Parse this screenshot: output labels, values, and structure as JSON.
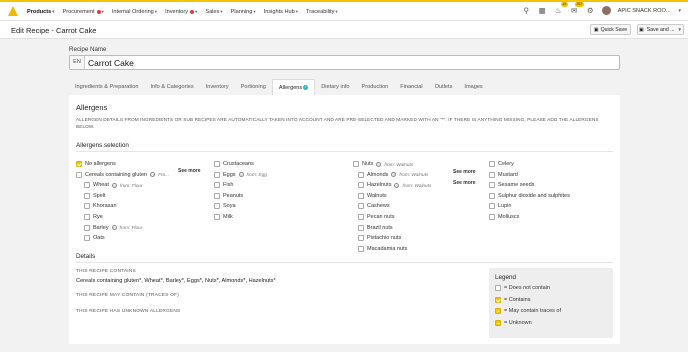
{
  "nav": {
    "items": [
      {
        "label": "Products",
        "active": true,
        "dot": false
      },
      {
        "label": "Procurement",
        "active": false,
        "dot": true
      },
      {
        "label": "Internal Ordering",
        "active": false,
        "dot": false
      },
      {
        "label": "Inventory",
        "active": false,
        "dot": true
      },
      {
        "label": "Sales",
        "active": false,
        "dot": false
      },
      {
        "label": "Planning",
        "active": false,
        "dot": false
      },
      {
        "label": "Insights Hub",
        "active": false,
        "dot": false
      },
      {
        "label": "Traceability",
        "active": false,
        "dot": false
      }
    ],
    "badge1": "14",
    "badge2": "197",
    "user": "APIC SNACK ROO...",
    "icons": [
      "search-icon",
      "store-icon",
      "bell-icon",
      "inbox-icon",
      "settings-icon"
    ]
  },
  "header": {
    "title": "Edit Recipe - Carrot Cake",
    "quick_save": "Quick Save",
    "save_and": "Save and ..."
  },
  "recipe": {
    "name_label": "Recipe Name",
    "lang": "EN",
    "name": "Carrot Cake"
  },
  "tabs": [
    {
      "label": "Ingredients & Preparation",
      "active": false
    },
    {
      "label": "Info & Categories",
      "active": false
    },
    {
      "label": "Inventory",
      "active": false
    },
    {
      "label": "Portioning",
      "active": false
    },
    {
      "label": "Allergens",
      "active": true
    },
    {
      "label": "Dietary info",
      "active": false
    },
    {
      "label": "Production",
      "active": false
    },
    {
      "label": "Financial",
      "active": false
    },
    {
      "label": "Outlets",
      "active": false
    },
    {
      "label": "Images",
      "active": false
    }
  ],
  "allergens": {
    "title": "Allergens",
    "info": "ALLERGEN DETAILS FROM INGREDIENTS OR SUB RECIPES ARE AUTOMATICALLY TAKEN INTO ACCOUNT AND ARE PRE-SELECTED AND MARKED WITH AN \"*\". IF THERE IS ANYTHING MISSING, PLEASE ADD THE ALLERGENS BELOW.",
    "selection_title": "Allergens selection",
    "see_more": "See more",
    "col1": [
      {
        "label": "No allergens",
        "state": "checked",
        "indent": false
      },
      {
        "label": "Cereals containing gluten",
        "state": "empty",
        "indent": false,
        "from": "Fro..."
      },
      {
        "label": "Wheat",
        "state": "empty",
        "indent": true,
        "from": "from: Flour"
      },
      {
        "label": "Spelt",
        "state": "empty",
        "indent": true
      },
      {
        "label": "Khorasan",
        "state": "empty",
        "indent": true
      },
      {
        "label": "Rye",
        "state": "empty",
        "indent": true
      },
      {
        "label": "Barley",
        "state": "empty",
        "indent": true,
        "from": "from: Flour"
      },
      {
        "label": "Oats",
        "state": "empty",
        "indent": true
      }
    ],
    "col2": [
      {
        "label": "Crustaceans",
        "state": "empty"
      },
      {
        "label": "Eggs",
        "state": "empty",
        "from": "from: Egg"
      },
      {
        "label": "Fish",
        "state": "empty"
      },
      {
        "label": "Peanuts",
        "state": "empty"
      },
      {
        "label": "Soya",
        "state": "empty"
      },
      {
        "label": "Milk",
        "state": "empty"
      }
    ],
    "col3": [
      {
        "label": "Nuts",
        "state": "empty",
        "indent": false,
        "from": "from: Walnuts"
      },
      {
        "label": "Almonds",
        "state": "empty",
        "indent": true,
        "from": "from: Walnuts"
      },
      {
        "label": "Hazelnuts",
        "state": "empty",
        "indent": true,
        "from": "from: Walnuts"
      },
      {
        "label": "Walnuts",
        "state": "empty",
        "indent": true
      },
      {
        "label": "Cashews",
        "state": "empty",
        "indent": true
      },
      {
        "label": "Pecan nuts",
        "state": "empty",
        "indent": true
      },
      {
        "label": "Brazil nuts",
        "state": "empty",
        "indent": true
      },
      {
        "label": "Pistachio nuts",
        "state": "empty",
        "indent": true
      },
      {
        "label": "Macadamia nuts",
        "state": "empty",
        "indent": true
      }
    ],
    "col4": [
      {
        "label": "Celery",
        "state": "empty"
      },
      {
        "label": "Mustard",
        "state": "empty"
      },
      {
        "label": "Sesame seeds",
        "state": "empty"
      },
      {
        "label": "Sulphur dioxide and sulphites",
        "state": "empty"
      },
      {
        "label": "Lupin",
        "state": "empty"
      },
      {
        "label": "Molluscs",
        "state": "empty"
      }
    ]
  },
  "details": {
    "title": "Details",
    "contains_label": "THIS RECIPE CONTAINS",
    "contains_value": "Cereals containing gluten*, Wheat*, Barley*, Eggs*, Nuts*, Almonds*, Hazelnuts*",
    "may_contain_label": "THIS RECIPE MAY CONTAIN (TRACES OF)",
    "unknown_label": "THIS RECIPE HAS UNKNOWN ALLERGENS"
  },
  "legend": {
    "title": "Legend",
    "items": [
      {
        "state": "empty",
        "label": "= Does not contain"
      },
      {
        "state": "checked",
        "label": "= Contains"
      },
      {
        "state": "question",
        "label": "= May contain traces of"
      },
      {
        "state": "unknown",
        "label": "= Unknown"
      }
    ]
  },
  "colors": {
    "accent": "#f5c400",
    "tab_check": "#2bb3c0",
    "nav_dot": "#e53935"
  }
}
